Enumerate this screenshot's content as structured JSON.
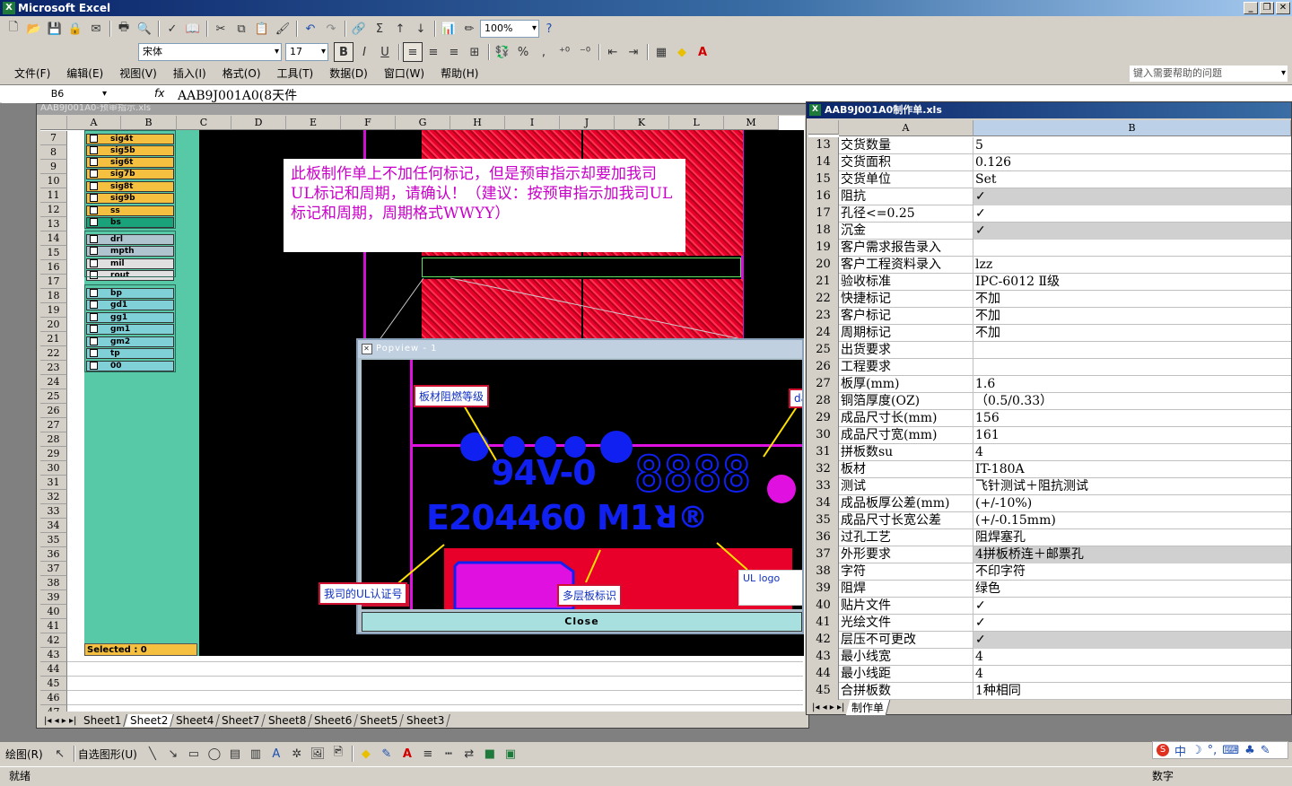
{
  "app": {
    "title": "Microsoft Excel",
    "icon": "excel-icon"
  },
  "menu": [
    "文件(F)",
    "编辑(E)",
    "视图(V)",
    "插入(I)",
    "格式(O)",
    "工具(T)",
    "数据(D)",
    "窗口(W)",
    "帮助(H)"
  ],
  "help_box": "键入需要帮助的问题",
  "toolbar": {
    "zoom": "100%",
    "font": "宋体",
    "size": "17",
    "bold": "B",
    "italic": "I",
    "underline": "U",
    "percent": "%",
    "comma": ",",
    "sigma": "Σ"
  },
  "formula": {
    "name_box": "B6",
    "fx": "fx",
    "value": "AAB9J001A0(8天件"
  },
  "left_window": {
    "title": "AAB9J001A0-预审指示.xls",
    "columns": [
      "A",
      "B",
      "C",
      "D",
      "E",
      "F",
      "G",
      "H",
      "I",
      "J",
      "K",
      "L",
      "M"
    ],
    "rows": [
      "7",
      "8",
      "9",
      "10",
      "11",
      "12",
      "13",
      "14",
      "15",
      "16",
      "17",
      "18",
      "19",
      "20",
      "21",
      "22",
      "23",
      "24",
      "25",
      "26",
      "27",
      "28",
      "29",
      "30",
      "31",
      "32",
      "33",
      "34",
      "35",
      "36",
      "37",
      "38",
      "39",
      "40",
      "41",
      "42",
      "43",
      "44",
      "45",
      "46",
      "47"
    ],
    "layers": [
      {
        "name": "sig4t",
        "color": "#f5c040"
      },
      {
        "name": "sig5b",
        "color": "#f5c040"
      },
      {
        "name": "sig6t",
        "color": "#f5c040"
      },
      {
        "name": "sig7b",
        "color": "#f5c040"
      },
      {
        "name": "sig8t",
        "color": "#f5c040"
      },
      {
        "name": "sig9b",
        "color": "#f5c040"
      },
      {
        "name": "ss",
        "color": "#f5c040"
      },
      {
        "name": "bs",
        "color": "#1aa37a"
      },
      {
        "name": "drl",
        "color": "#b0c4d0"
      },
      {
        "name": "mpth",
        "color": "#b0c4d0"
      },
      {
        "name": "mil",
        "color": "#e0e0e0"
      },
      {
        "name": "rout",
        "color": "#e0e0e0"
      },
      {
        "name": "bp",
        "color": "#80d0d8"
      },
      {
        "name": "gd1",
        "color": "#80d0d8"
      },
      {
        "name": "gg1",
        "color": "#80d0d8"
      },
      {
        "name": "gm1",
        "color": "#80d0d8"
      },
      {
        "name": "gm2",
        "color": "#80d0d8"
      },
      {
        "name": "tp",
        "color": "#80d0d8"
      },
      {
        "name": "00",
        "color": "#80d0d8"
      }
    ],
    "selected": "Selected : 0",
    "note": "此板制作单上不加任何标记，但是预审指示却要加我司UL标记和周期，请确认！（建议：按预审指示加我司UL标记和周期，周期格式WWYY）",
    "sheets": [
      "Sheet1",
      "Sheet2",
      "Sheet4",
      "Sheet7",
      "Sheet8",
      "Sheet6",
      "Sheet5",
      "Sheet3"
    ]
  },
  "popview": {
    "title": "Popview - 1",
    "marking_94v": "94V-0",
    "marking_date": "8888",
    "marking_ul": "E204460 M1",
    "ul_symbol": "ꓤ®",
    "annotations": {
      "flame": "板材阻燃等级",
      "ul_no": "我司的UL认证号",
      "multilayer": "多层板标识",
      "ul_logo": "UL logo",
      "date": "dat"
    },
    "close": "Close"
  },
  "right_window": {
    "title": "AAB9J001A0制作单.xls",
    "columns": [
      "A",
      "B"
    ],
    "rows": [
      {
        "n": "13",
        "a": "交货数量",
        "b": "5"
      },
      {
        "n": "14",
        "a": "交货面积",
        "b": "0.126"
      },
      {
        "n": "15",
        "a": "交货单位",
        "b": "Set"
      },
      {
        "n": "16",
        "a": "阻抗",
        "b": "✓",
        "hl": true
      },
      {
        "n": "17",
        "a": "孔径<=0.25",
        "b": "✓"
      },
      {
        "n": "18",
        "a": "沉金",
        "b": "✓",
        "hl": true
      },
      {
        "n": "19",
        "a": "客户需求报告录入",
        "b": ""
      },
      {
        "n": "20",
        "a": "客户工程资料录入",
        "b": "lzz"
      },
      {
        "n": "21",
        "a": "验收标准",
        "b": "IPC-6012 Ⅱ级"
      },
      {
        "n": "22",
        "a": "快捷标记",
        "b": "不加"
      },
      {
        "n": "23",
        "a": "客户标记",
        "b": "不加"
      },
      {
        "n": "24",
        "a": "周期标记",
        "b": "不加"
      },
      {
        "n": "25",
        "a": "出货要求",
        "b": ""
      },
      {
        "n": "26",
        "a": "工程要求",
        "b": ""
      },
      {
        "n": "27",
        "a": "板厚(mm)",
        "b": "1.6"
      },
      {
        "n": "28",
        "a": "铜箔厚度(OZ)",
        "b": "（0.5/0.33）"
      },
      {
        "n": "29",
        "a": "成品尺寸长(mm)",
        "b": "156"
      },
      {
        "n": "30",
        "a": "成品尺寸宽(mm)",
        "b": "161"
      },
      {
        "n": "31",
        "a": "拼板数su",
        "b": "4"
      },
      {
        "n": "32",
        "a": "板材",
        "b": "IT-180A"
      },
      {
        "n": "33",
        "a": "测试",
        "b": "飞针测试＋阻抗测试"
      },
      {
        "n": "34",
        "a": "成品板厚公差(mm)",
        "b": "(+/-10%)"
      },
      {
        "n": "35",
        "a": "成品尺寸长宽公差",
        "b": "(+/-0.15mm)"
      },
      {
        "n": "36",
        "a": "过孔工艺",
        "b": "阻焊塞孔"
      },
      {
        "n": "37",
        "a": "外形要求",
        "b": "4拼板桥连＋邮票孔",
        "hl": true
      },
      {
        "n": "38",
        "a": "字符",
        "b": "不印字符"
      },
      {
        "n": "39",
        "a": "阻焊",
        "b": "绿色"
      },
      {
        "n": "40",
        "a": "贴片文件",
        "b": "✓"
      },
      {
        "n": "41",
        "a": "光绘文件",
        "b": "✓"
      },
      {
        "n": "42",
        "a": "层压不可更改",
        "b": "✓",
        "hl": true
      },
      {
        "n": "43",
        "a": "最小线宽",
        "b": "4"
      },
      {
        "n": "44",
        "a": "最小线距",
        "b": "4"
      },
      {
        "n": "45",
        "a": "合拼板数",
        "b": "1种相同"
      }
    ],
    "sheet_tab": "制作单"
  },
  "drawing": {
    "draw": "绘图(R)",
    "autoshape": "自选图形(U)"
  },
  "status": {
    "ready": "就绪",
    "num": "数字"
  },
  "ime": [
    "S",
    "中",
    "☽",
    "°,",
    "⌨",
    "♣",
    "✎"
  ]
}
